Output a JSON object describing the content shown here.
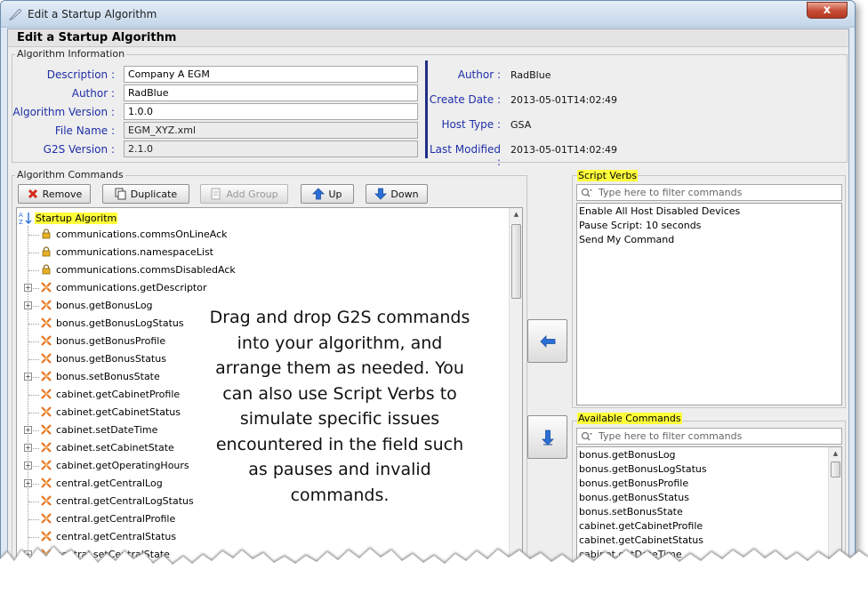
{
  "window": {
    "title": "Edit a Startup Algorithm",
    "close_glyph": "x"
  },
  "dialog": {
    "heading": "Edit a Startup Algorithm"
  },
  "algorithm_information": {
    "group_label": "Algorithm Information",
    "fields": [
      {
        "label": "Description :",
        "value": "Company A EGM",
        "readonly": false
      },
      {
        "label": "Author :",
        "value": "RadBlue",
        "readonly": false
      },
      {
        "label": "Algorithm Version :",
        "value": "1.0.0",
        "readonly": false
      },
      {
        "label": "File Name :",
        "value": "EGM_XYZ.xml",
        "readonly": true
      },
      {
        "label": "G2S Version :",
        "value": "2.1.0",
        "readonly": true
      }
    ],
    "info": [
      {
        "label": "Author :",
        "value": "RadBlue"
      },
      {
        "label": "Create Date :",
        "value": "2013-05-01T14:02:49"
      },
      {
        "label": "Host Type :",
        "value": "GSA"
      },
      {
        "label": "Last Modified :",
        "value": "2013-05-01T14:02:49"
      }
    ]
  },
  "algorithm_commands": {
    "group_label": "Algorithm Commands",
    "toolbar": {
      "remove": "Remove",
      "duplicate": "Duplicate",
      "add_group": "Add Group",
      "up": "Up",
      "down": "Down"
    },
    "tree": {
      "root_label": "Startup Algoritm",
      "items": [
        {
          "label": "communications.commsOnLineAck",
          "icon": "lock-icon",
          "expandable": false
        },
        {
          "label": "communications.namespaceList",
          "icon": "lock-icon",
          "expandable": false
        },
        {
          "label": "communications.commsDisabledAck",
          "icon": "lock-icon",
          "expandable": false
        },
        {
          "label": "communications.getDescriptor",
          "icon": "command-icon",
          "expandable": true
        },
        {
          "label": "bonus.getBonusLog",
          "icon": "command-icon",
          "expandable": true
        },
        {
          "label": "bonus.getBonusLogStatus",
          "icon": "command-icon",
          "expandable": false
        },
        {
          "label": "bonus.getBonusProfile",
          "icon": "command-icon",
          "expandable": false
        },
        {
          "label": "bonus.getBonusStatus",
          "icon": "command-icon",
          "expandable": false
        },
        {
          "label": "bonus.setBonusState",
          "icon": "command-icon",
          "expandable": true
        },
        {
          "label": "cabinet.getCabinetProfile",
          "icon": "command-icon",
          "expandable": false
        },
        {
          "label": "cabinet.getCabinetStatus",
          "icon": "command-icon",
          "expandable": false
        },
        {
          "label": "cabinet.setDateTime",
          "icon": "command-icon",
          "expandable": true
        },
        {
          "label": "cabinet.setCabinetState",
          "icon": "command-icon",
          "expandable": true
        },
        {
          "label": "cabinet.getOperatingHours",
          "icon": "command-icon",
          "expandable": true
        },
        {
          "label": "central.getCentralLog",
          "icon": "command-icon",
          "expandable": true
        },
        {
          "label": "central.getCentralLogStatus",
          "icon": "command-icon",
          "expandable": false
        },
        {
          "label": "central.getCentralProfile",
          "icon": "command-icon",
          "expandable": false
        },
        {
          "label": "central.getCentralStatus",
          "icon": "command-icon",
          "expandable": false
        },
        {
          "label": "central.setCentralState",
          "icon": "command-icon",
          "expandable": true
        }
      ]
    }
  },
  "annotation": {
    "lines": [
      "Drag and drop G2S commands",
      "into your algorithm, and",
      "arrange them as needed. You",
      "can also use Script Verbs to",
      "simulate specific issues",
      "encountered in the field such",
      "as pauses and invalid",
      "commands."
    ]
  },
  "script_verbs": {
    "label": "Script Verbs",
    "filter_placeholder": "Type here to filter commands",
    "items": [
      "Enable All Host Disabled Devices",
      "Pause Script: 10 seconds",
      "Send My Command"
    ]
  },
  "available_commands": {
    "label": "Available Commands",
    "filter_placeholder": "Type here to filter commands",
    "items": [
      "bonus.getBonusLog",
      "bonus.getBonusLogStatus",
      "bonus.getBonusProfile",
      "bonus.getBonusStatus",
      "bonus.setBonusState",
      "cabinet.getCabinetProfile",
      "cabinet.getCabinetStatus",
      "cabinet.getDateTime"
    ]
  },
  "colors": {
    "label_blue": "#1f2fa8",
    "highlight_yellow": "#ffff3a",
    "command_orange": "#e8731e",
    "arrow_blue": "#2a6fd6",
    "remove_red": "#d42a1a"
  }
}
